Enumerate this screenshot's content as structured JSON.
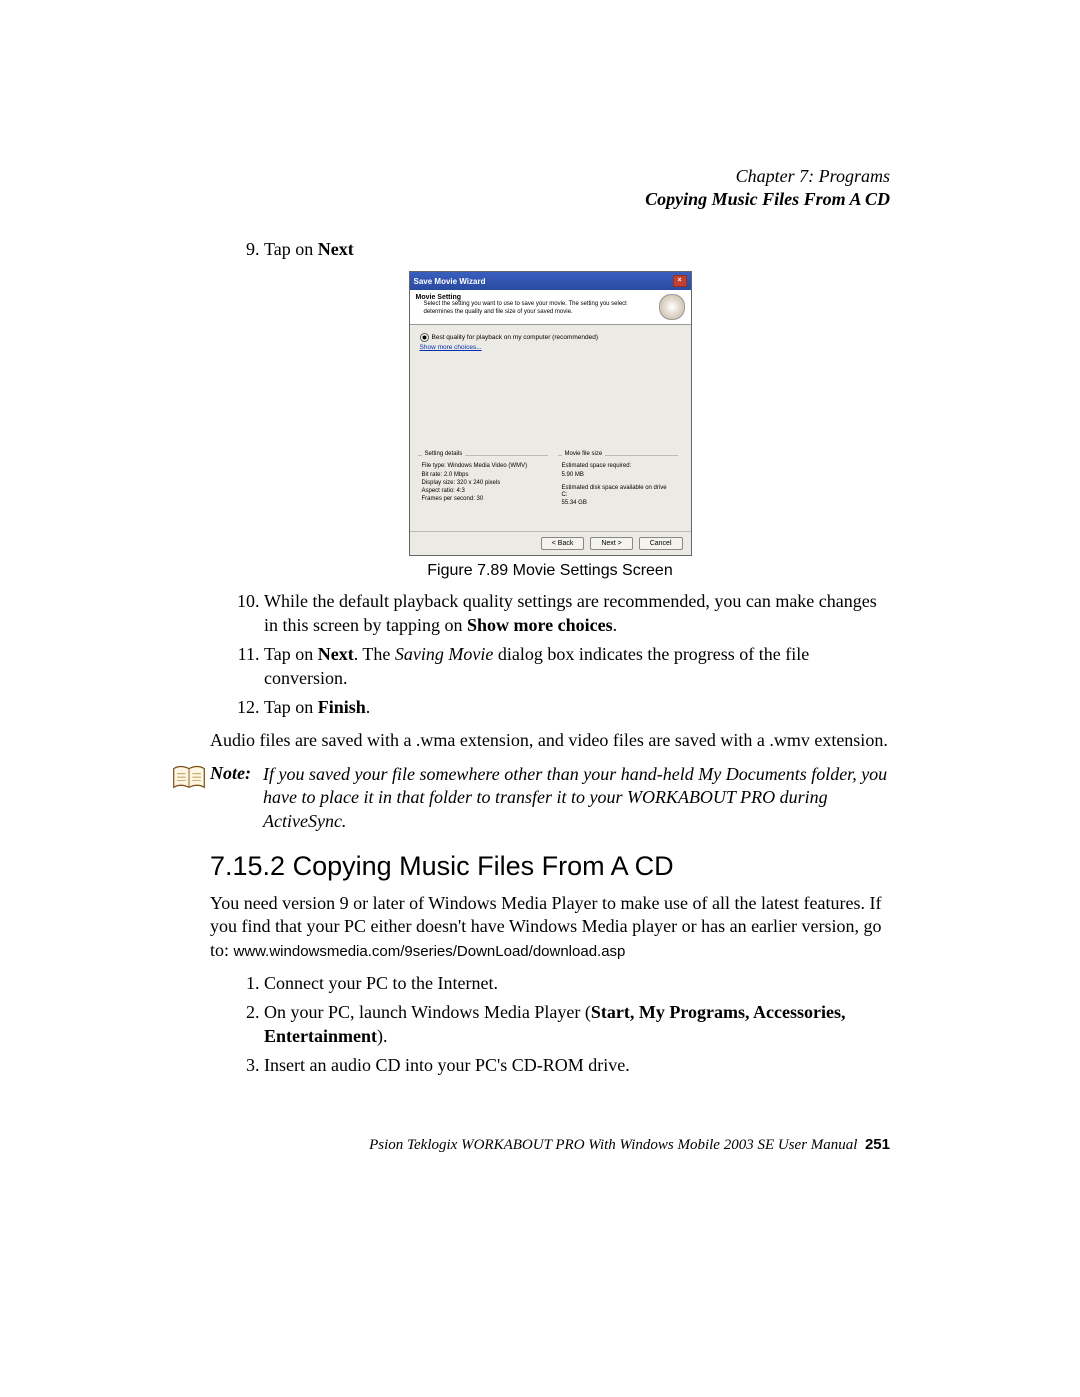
{
  "header": {
    "chapter": "Chapter 7:  Programs",
    "section_running": "Copying Music Files From A CD"
  },
  "steps_a": [
    {
      "num": "9",
      "prefix": "Tap on ",
      "bold": "Next",
      "suffix": ""
    }
  ],
  "wizard": {
    "title": "Save Movie Wizard",
    "close": "×",
    "head_title": "Movie Setting",
    "head_desc": "Select the setting you want to use to save your movie. The setting you select determines the quality and file size of your saved movie.",
    "radio_label": "Best quality for playback on my computer (recommended)",
    "show_more": "Show more choices...",
    "group_left_title": "Setting details",
    "group_left_lines": [
      "File type: Windows Media Video (WMV)",
      "Bit rate: 2.0 Mbps",
      "Display size: 320 x 240 pixels",
      "Aspect ratio: 4:3",
      "Frames per second: 30"
    ],
    "group_right_title": "Movie file size",
    "group_right_a_label": "Estimated space required:",
    "group_right_a_value": "5.90 MB",
    "group_right_b_label": "Estimated disk space available on drive C:",
    "group_right_b_value": "55.34 GB",
    "btn_back": "< Back",
    "btn_next": "Next >",
    "btn_cancel": "Cancel"
  },
  "figure_caption": "Figure 7.89 Movie Settings Screen",
  "steps_b": [
    {
      "num": "10",
      "text_a": "While the default playback quality settings are recommended, you can make changes in this screen by tapping on ",
      "bold_a": "Show more choices",
      "text_b": "."
    },
    {
      "num": "11",
      "text_a": "Tap on ",
      "bold_a": "Next",
      "text_b": ". The ",
      "ital": "Saving Movie",
      "text_c": " dialog box indicates the progress of the file conversion."
    },
    {
      "num": "12",
      "text_a": "Tap on ",
      "bold_a": "Finish",
      "text_b": "."
    }
  ],
  "para_audio": "Audio files are saved with a .wma extension, and video files are saved with a .wmv extension.",
  "note": {
    "label": "Note:",
    "text": "If you saved your file somewhere other than your hand-held My Documents folder, you have to place it in that folder to transfer it to your WORKABOUT PRO during ActiveSync."
  },
  "section_heading": "7.15.2   Copying Music Files From A CD",
  "para_intro_a": "You need version 9 or later of Windows Media Player to make use of all the latest features. If you find that your PC either doesn't have Windows Media player or has an earlier version, go to: ",
  "para_intro_url": "www.windowsmedia.com/9series/DownLoad/download.asp",
  "steps_c": [
    {
      "num": "1",
      "text": "Connect your PC to the Internet."
    },
    {
      "num": "2",
      "text_a": "On your PC, launch Windows Media Player (",
      "bold": "Start, My Programs, Accessories, Entertainment",
      "text_b": ")."
    },
    {
      "num": "3",
      "text": "Insert an audio CD into your PC's CD-ROM drive."
    }
  ],
  "footer": {
    "title": "Psion Teklogix WORKABOUT PRO With Windows Mobile 2003 SE User Manual",
    "page": "251"
  }
}
